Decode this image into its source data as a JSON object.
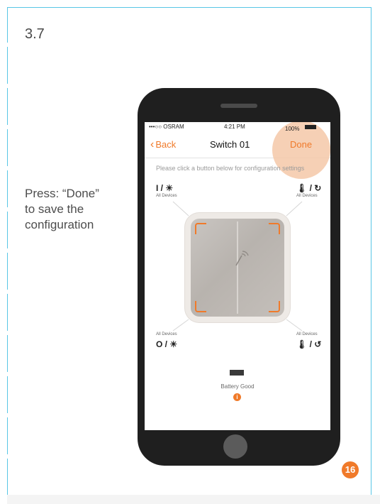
{
  "step": {
    "number": "3.7"
  },
  "instruction": {
    "lines": [
      "Press: “Done”",
      "to save the",
      "configuration"
    ]
  },
  "phone": {
    "statusbar": {
      "carrier": "•••○○ OSRAM",
      "time": "4:21 PM",
      "battery_pct": "100%"
    },
    "navbar": {
      "back_label": "Back",
      "title": "Switch 01",
      "done_label": "Done"
    },
    "hint": "Please click a button below for configuration settings",
    "quadrants": {
      "top_left": {
        "icon": "I / ☀",
        "label": "All Devices"
      },
      "top_right": {
        "icon": "🌡 / ↻",
        "label": "All Devices"
      },
      "bottom_left": {
        "icon": "O / ☀",
        "label": "All Devices"
      },
      "bottom_right": {
        "icon": "🌡 / ↺",
        "label": "All Devices"
      }
    },
    "battery": {
      "status": "Battery Good",
      "info_icon": "i"
    }
  },
  "page_number": "16",
  "colors": {
    "accent": "#f07a2a",
    "frame": "#58c6e6"
  }
}
